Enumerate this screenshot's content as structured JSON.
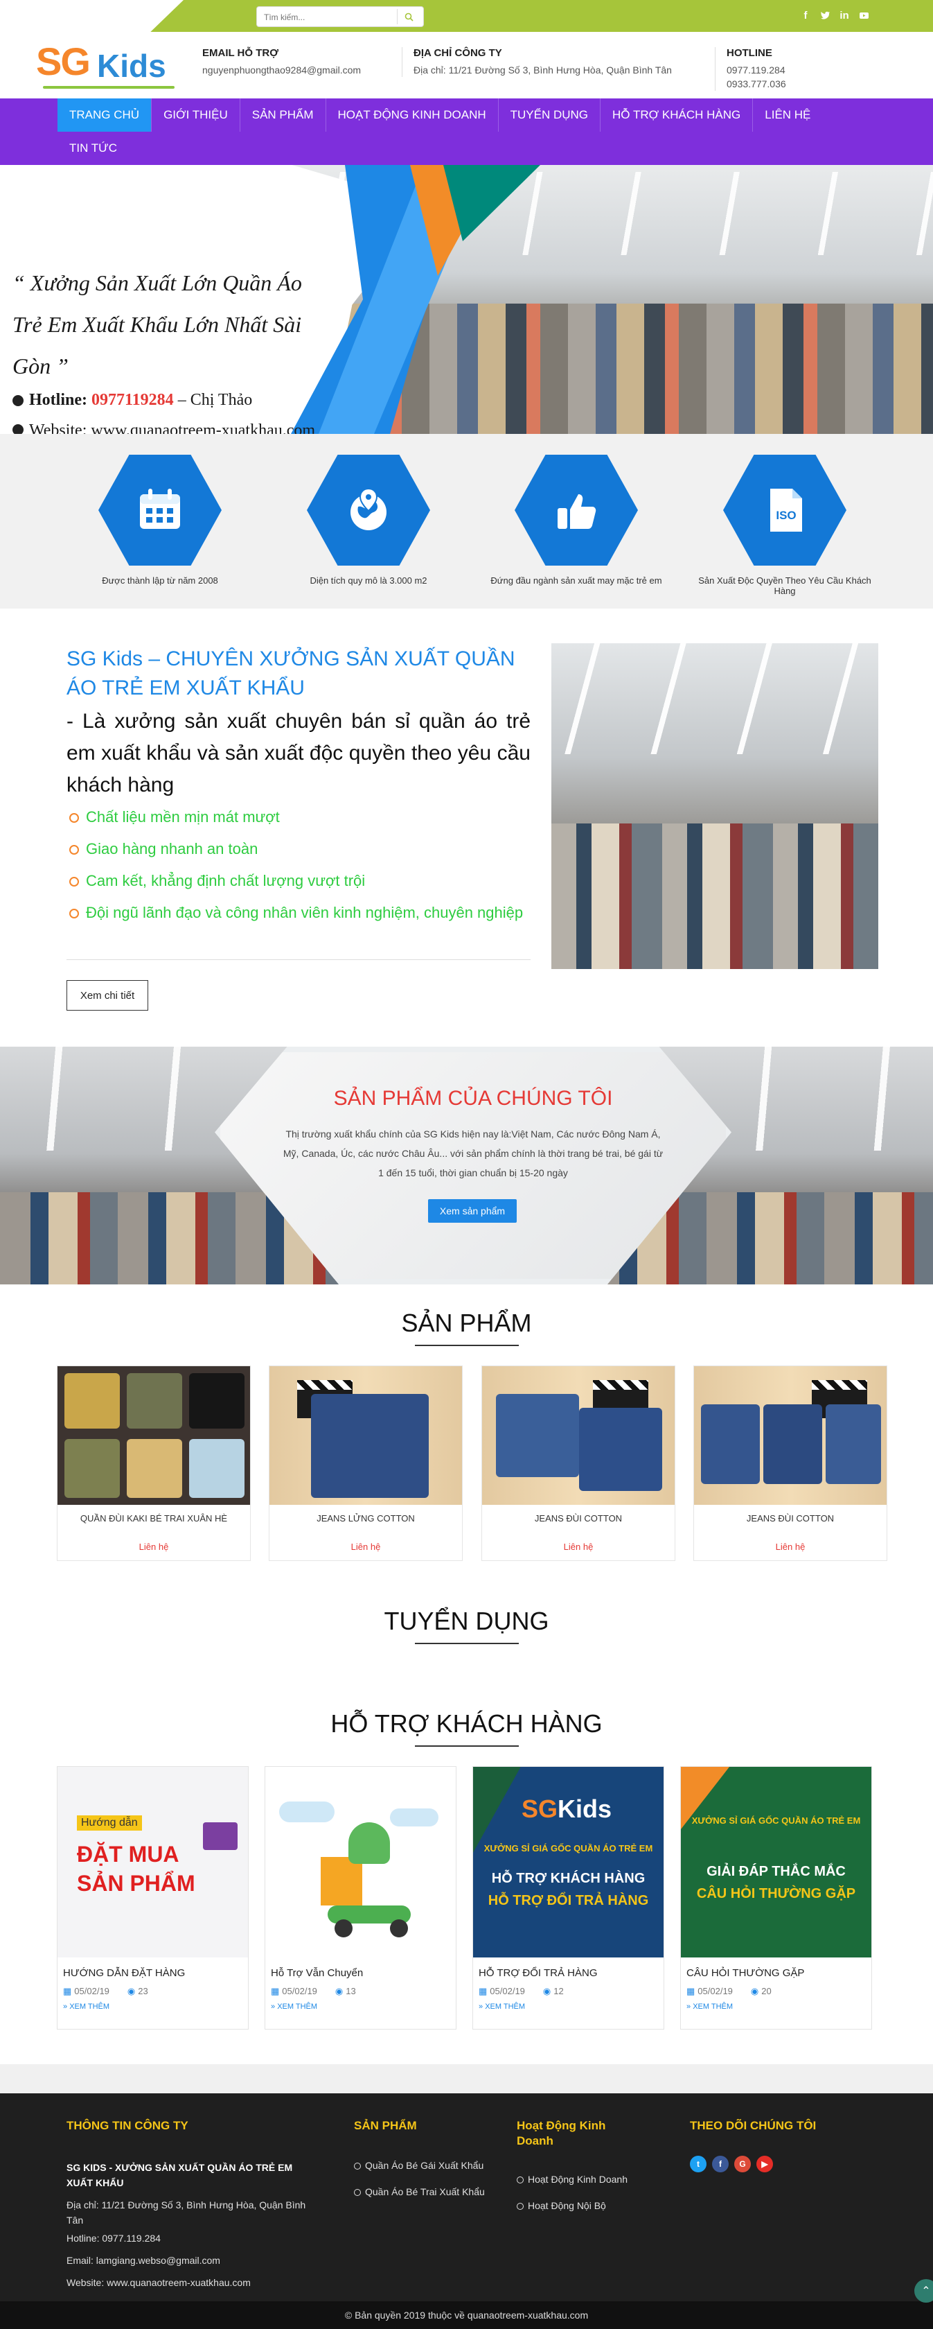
{
  "topbar": {
    "search_placeholder": "Tìm kiếm...",
    "social_icons": [
      "facebook-icon",
      "twitter-icon",
      "linkedin-icon",
      "youtube-icon"
    ]
  },
  "header": {
    "logo_sg": "SG",
    "logo_kids": "Kids",
    "email_title": "EMAIL HỖ TRỢ",
    "email_value": "nguyenphuongthao9284@gmail.com",
    "address_title": "ĐỊA CHỈ CÔNG TY",
    "address_value": "Địa chỉ: 11/21 Đường Số 3, Bình Hưng Hòa, Quận Bình Tân",
    "hotline_title": "HOTLINE",
    "hotline_1": "0977.119.284",
    "hotline_2": "0933.777.036"
  },
  "nav": {
    "items": [
      "TRANG CHỦ",
      "GIỚI THIỆU",
      "SẢN PHẨM",
      "HOẠT ĐỘNG KINH DOANH",
      "TUYỂN DỤNG",
      "HỖ TRỢ KHÁCH HÀNG",
      "LIÊN HỆ",
      "TIN TỨC"
    ],
    "active": "TRANG CHỦ"
  },
  "hero": {
    "quote_line1": "“ Xưởng Sản Xuất Lớn Quần Áo",
    "quote_line2": "Trẻ Em Xuất Khẩu Lớn Nhất Sài",
    "quote_line3": "Gòn ”",
    "hotline_label": "Hotline:",
    "hotline_number": "0977119284",
    "hotline_contact": " – Chị Thảo",
    "website_partial": "Website: www.quanaotreem-xuatkhau.com"
  },
  "features": [
    {
      "icon": "calendar-icon",
      "text": "Được thành lập từ năm 2008"
    },
    {
      "icon": "globe-pin-icon",
      "text": "Diện tích quy mô là 3.000 m2"
    },
    {
      "icon": "thumbs-up-icon",
      "text": "Đứng đầu ngành sản xuất may mặc trẻ em"
    },
    {
      "icon": "iso-icon",
      "text": "Sản Xuất Độc Quyền Theo Yêu Cầu Khách Hàng"
    }
  ],
  "about": {
    "title": "SG Kids – CHUYÊN XƯỞNG SẢN XUẤT QUẦN ÁO TRẺ EM XUẤT KHẨU",
    "description": "- Là xưởng sản xuất chuyên bán sỉ quần áo trẻ em xuất khẩu và sản xuất độc quyền theo yêu cầu khách hàng",
    "bullets": [
      "Chất liệu mền mịn mát mượt",
      "Giao hàng nhanh an toàn",
      "Cam kết, khẳng định chất lượng vượt trội",
      " Đội ngũ lãnh đạo và công nhân viên kinh nghiệm, chuyên nghiệp"
    ],
    "button": "Xem chi tiết"
  },
  "banner": {
    "title": "SẢN PHẨM CỦA CHÚNG TÔI",
    "text": "Thị trường xuất khẩu chính của SG Kids hiện nay là:Việt Nam, Các nước Đông Nam Á, Mỹ, Canada, Úc, các nước Châu Âu... với sản phẩm chính là thời trang bé trai, bé gái từ 1 đến 15 tuổi, thời gian chuẩn bị 15-20 ngày",
    "button": "Xem sản phẩm"
  },
  "products": {
    "title": "SẢN PHẨM",
    "items": [
      {
        "name": "QUẦN ĐÙI KAKI BÉ TRAI XUÂN HÈ",
        "price": "Liên hệ"
      },
      {
        "name": "JEANS LỬNG COTTON",
        "price": "Liên hệ"
      },
      {
        "name": "JEANS ĐÙI COTTON",
        "price": "Liên hệ"
      },
      {
        "name": "JEANS ĐÙI COTTON",
        "price": "Liên hệ"
      }
    ]
  },
  "recruit": {
    "title": "TUYỂN DỤNG"
  },
  "support": {
    "title": "HỖ TRỢ KHÁCH HÀNG",
    "items": [
      {
        "title": "HƯỚNG DẪN ĐẶT HÀNG",
        "date": "05/02/19",
        "views": "23",
        "more": "XEM THÊM",
        "img_l1": "Hướng dẫn",
        "img_l2": "ĐẶT MUA",
        "img_l3": "SẢN PHẨM"
      },
      {
        "title": "Hỗ Trợ Vẫn Chuyển",
        "date": "05/02/19",
        "views": "13",
        "more": "XEM THÊM"
      },
      {
        "title": "HỖ TRỢ ĐỔI TRẢ HÀNG",
        "date": "05/02/19",
        "views": "12",
        "more": "XEM THÊM",
        "img_l1": "XƯỞNG SỈ GIÁ GỐC QUẦN ÁO TRẺ EM",
        "img_l2": "HỖ TRỢ KHÁCH HÀNG",
        "img_l3": "HỖ TRỢ ĐỔI TRẢ HÀNG"
      },
      {
        "title": "CÂU HỎI THƯỜNG GẶP",
        "date": "05/02/19",
        "views": "20",
        "more": "XEM THÊM",
        "img_l1": "XƯỞNG SỈ GIÁ GỐC QUẦN ÁO TRẺ EM",
        "img_l2": "GIẢI ĐÁP THẮC MẮC",
        "img_l3": "CÂU HỎI THƯỜNG GẶP"
      }
    ]
  },
  "footer": {
    "company_title": "THÔNG TIN CÔNG TY",
    "company_name": "SG KIDS - XƯỞNG SẢN XUẤT QUẦN ÁO TRẺ EM XUẤT KHẨU",
    "address": "Địa chỉ: 11/21 Đường Số 3, Bình Hưng Hòa, Quận Bình Tân",
    "hotline": "Hotline: 0977.119.284",
    "email": "Email: lamgiang.webso@gmail.com",
    "website": "Website: www.quanaotreem-xuatkhau.com",
    "products_title": "SẢN PHẨM",
    "products": [
      "Quần Áo Bé Gái Xuất Khẩu",
      "Quần Áo Bé Trai Xuất Khẩu"
    ],
    "business_title": "Hoạt Động Kinh Doanh",
    "business": [
      "Hoạt Động Kinh Doanh",
      "Hoạt Động Nội Bộ"
    ],
    "follow_title": "THEO DÕI CHÚNG TÔI",
    "copyright": "© Bản quyền 2019 thuộc về quanaotreem-xuatkhau.com"
  },
  "colors": {
    "accent_green": "#a6c53a",
    "nav_purple": "#7e2fdc",
    "active_blue": "#2196f3",
    "feature_blue": "#1378d6",
    "highlight_red": "#e53935"
  }
}
